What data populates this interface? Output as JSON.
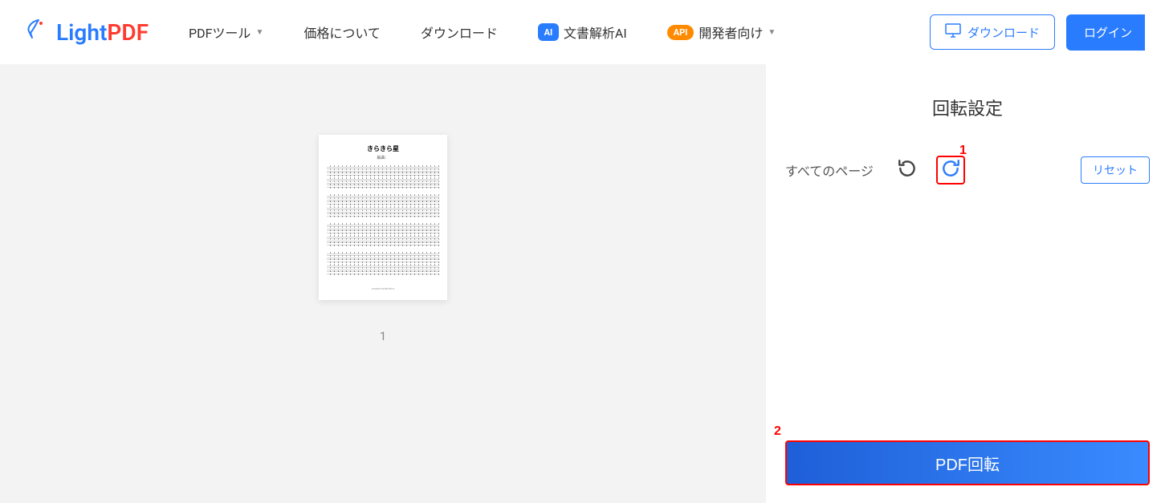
{
  "logo": {
    "light": "Light",
    "pdf": "PDF"
  },
  "nav": {
    "tools": "PDFツール",
    "pricing": "価格について",
    "download": "ダウンロード",
    "ai": "文書解析AI",
    "ai_badge": "AI",
    "api_badge": "API",
    "developer": "開発者向け"
  },
  "header": {
    "download_btn": "ダウンロード",
    "login_btn": "ログイン"
  },
  "preview": {
    "doc_title": "きらきら星",
    "doc_subtitle": "編曲：",
    "page_footer": "music-note-hiro",
    "page_number": "1"
  },
  "sidebar": {
    "title": "回転設定",
    "all_pages_label": "すべてのページ",
    "reset": "リセット",
    "action": "PDF回転"
  },
  "annotations": {
    "one": "1",
    "two": "2"
  }
}
